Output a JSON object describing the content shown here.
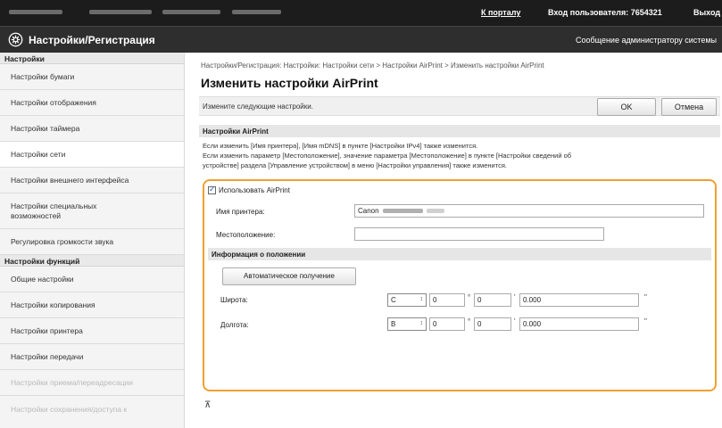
{
  "topbar": {
    "portal_link": "К порталу",
    "login_label": "Вход пользователя: 7654321",
    "logout_link": "Выход"
  },
  "header": {
    "app_title": "Настройки/Регистрация",
    "admin_message": "Сообщение администратору системы",
    "icon": "gear-icon"
  },
  "sidebar": {
    "section_settings": "Настройки",
    "settings_items": [
      "Настройки бумаги",
      "Настройки отображения",
      "Настройки таймера",
      "Настройки сети",
      "Настройки внешнего интерфейса",
      "Настройки специальных возможностей",
      "Регулировка громкости звука"
    ],
    "section_functions": "Настройки функций",
    "function_items": [
      "Общие настройки",
      "Настройки копирования",
      "Настройки принтера",
      "Настройки передачи",
      "Настройки приема/переадресации",
      "Настройки сохранения/доступа к"
    ]
  },
  "main": {
    "breadcrumb": "Настройки/Регистрация: Настройки: Настройки сети > Настройки AirPrint > Изменить настройки AirPrint",
    "title": "Изменить настройки AirPrint",
    "instruction": "Измените следующие настройки.",
    "ok_label": "OK",
    "cancel_label": "Отмена",
    "section_title": "Настройки AirPrint",
    "desc_line1": "Если изменить [Имя принтера], [Имя mDNS] в пункте [Настройки IPv4] также изменится.",
    "desc_line2": "Если изменить параметр [Местоположение], значение параметра [Местоположение] в пункте [Настройки сведений об",
    "desc_line3": "устройстве] раздела [Управление устройством] в меню [Настройки управления] также изменится.",
    "use_airprint_label": "Использовать AirPrint",
    "use_airprint_checked": true,
    "printer_name_label": "Имя принтера:",
    "printer_name_value": "Canon",
    "location_label": "Местоположение:",
    "location_value": "",
    "position_header": "Информация о положении",
    "auto_get_label": "Автоматическое получение",
    "latitude_label": "Широта:",
    "latitude_dir": "С",
    "latitude_deg": "0",
    "latitude_min": "0",
    "latitude_sec": "0.000",
    "longitude_label": "Долгота:",
    "longitude_dir": "В",
    "longitude_deg": "0",
    "longitude_min": "0",
    "longitude_sec": "0.000",
    "deg_symbol": "°",
    "min_symbol": "'",
    "sec_symbol": "\""
  },
  "colors": {
    "highlight": "#f0a030",
    "topbar": "#1c1c1c",
    "titlebar": "#2e2e2e"
  }
}
